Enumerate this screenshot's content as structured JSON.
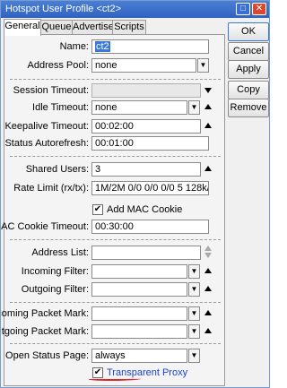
{
  "window": {
    "title": "Hotspot User Profile <ct2>",
    "maximize_glyph": "□",
    "close_glyph": "✕"
  },
  "tabs": [
    {
      "label": "General",
      "active": true
    },
    {
      "label": "Queue",
      "active": false
    },
    {
      "label": "Advertise",
      "active": false
    },
    {
      "label": "Scripts",
      "active": false
    }
  ],
  "form": {
    "name": {
      "label": "Name:",
      "value": "ct2"
    },
    "address_pool": {
      "label": "Address Pool:",
      "value": "none"
    },
    "session_timeout": {
      "label": "Session Timeout:",
      "value": ""
    },
    "idle_timeout": {
      "label": "Idle Timeout:",
      "value": "none"
    },
    "keepalive_timeout": {
      "label": "Keepalive Timeout:",
      "value": "00:02:00"
    },
    "status_autorefresh": {
      "label": "Status Autorefresh:",
      "value": "00:01:00"
    },
    "shared_users": {
      "label": "Shared Users:",
      "value": "3"
    },
    "rate_limit": {
      "label": "Rate Limit (rx/tx):",
      "value": "1M/2M 0/0 0/0 0/0 5 128k/12"
    },
    "add_mac_cookie": {
      "label": "Add MAC Cookie",
      "checked": true
    },
    "mac_cookie_timeout": {
      "label": "MAC Cookie Timeout:",
      "value": "00:30:00"
    },
    "address_list": {
      "label": "Address List:",
      "value": ""
    },
    "incoming_filter": {
      "label": "Incoming Filter:",
      "value": ""
    },
    "outgoing_filter": {
      "label": "Outgoing Filter:",
      "value": ""
    },
    "incoming_packet_mark": {
      "label": "Incoming Packet Mark:",
      "value": ""
    },
    "outgoing_packet_mark": {
      "label": "Outgoing Packet Mark:",
      "value": ""
    },
    "open_status_page": {
      "label": "Open Status Page:",
      "value": "always"
    },
    "transparent_proxy": {
      "label": "Transparent Proxy",
      "checked": true,
      "label_color": "#1a3fd0"
    },
    "dropdown_glyph": "▼",
    "check_glyph": "✔"
  },
  "buttons": {
    "ok": "OK",
    "cancel": "Cancel",
    "apply": "Apply",
    "copy": "Copy",
    "remove": "Remove"
  },
  "colors": {
    "title_bar": "#2f63c0",
    "highlight": "#3a78d8",
    "annotation": "#e0262a"
  }
}
